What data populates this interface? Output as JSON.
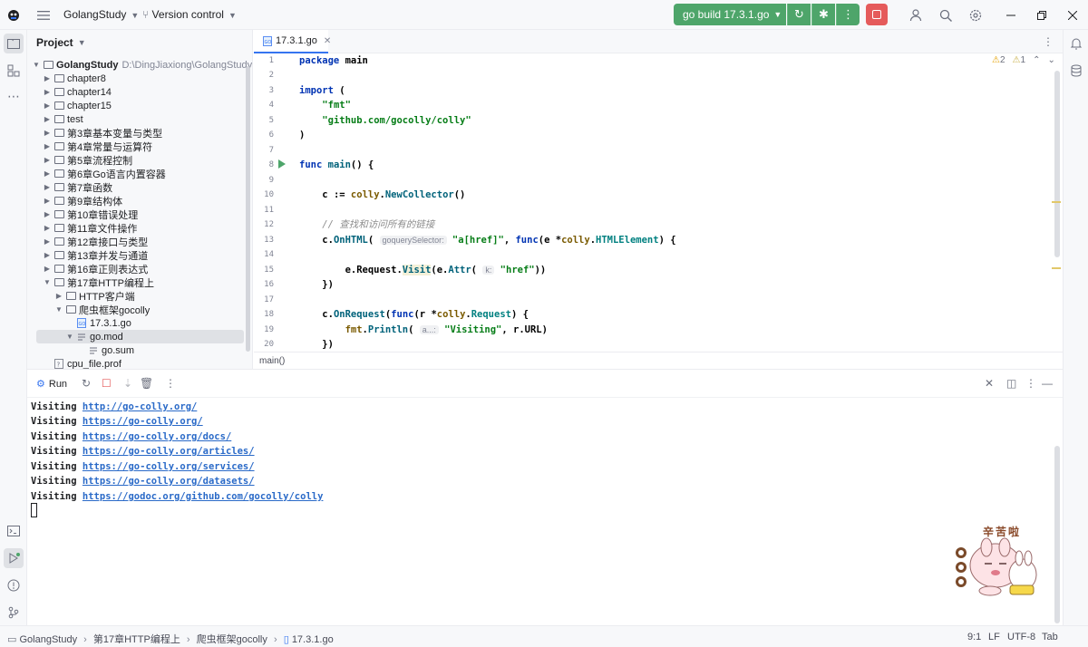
{
  "titlebar": {
    "project_name": "GolangStudy",
    "vcs_label": "Version control",
    "run_config": "go build 17.3.1.go"
  },
  "project_panel": {
    "title": "Project",
    "root_name": "GolangStudy",
    "root_path": "D:\\DingJiaxiong\\GolangStudy",
    "items": [
      "chapter8",
      "chapter14",
      "chapter15",
      "test",
      "第3章基本变量与类型",
      "第4章常量与运算符",
      "第5章流程控制",
      "第6章Go语言内置容器",
      "第7章函数",
      "第9章结构体",
      "第10章错误处理",
      "第11章文件操作",
      "第12章接口与类型",
      "第13章并发与通道",
      "第16章正则表达式",
      "第17章HTTP编程上",
      "HTTP客户端",
      "爬虫框架gocolly",
      "17.3.1.go",
      "go.mod",
      "go.sum",
      "cpu_file.prof"
    ]
  },
  "editor": {
    "tab_name": "17.3.1.go",
    "warnings": "2",
    "weak_warnings": "1",
    "line_numbers": [
      "1",
      "2",
      "3",
      "4",
      "5",
      "6",
      "7",
      "8",
      "9",
      "10",
      "11",
      "12",
      "13",
      "14",
      "15",
      "16",
      "17",
      "18",
      "19",
      "20"
    ],
    "breadcrumb": "main()",
    "hint_selector": "goquerySelector:",
    "hint_k": "k:",
    "hint_a": "a...:",
    "comment": "// 查找和访问所有的链接"
  },
  "run_panel": {
    "tab_label": "Run",
    "visiting_word": "Visiting",
    "urls": [
      "http://go-colly.org/",
      "https://go-colly.org/",
      "https://go-colly.org/docs/",
      "https://go-colly.org/articles/",
      "https://go-colly.org/services/",
      "https://go-colly.org/datasets/",
      "https://godoc.org/github.com/gocolly/colly"
    ]
  },
  "sticker": {
    "text": "辛苦啦"
  },
  "statusbar": {
    "crumbs": [
      "GolangStudy",
      "第17章HTTP编程上",
      "爬虫框架gocolly",
      "17.3.1.go"
    ],
    "position": "9:1",
    "line_sep": "LF",
    "encoding": "UTF-8",
    "indent": "Tab"
  },
  "icons": {
    "menu": "hamburger-icon",
    "branch": "branch-icon",
    "debug": "bug-icon",
    "search": "search-icon",
    "settings": "gear-icon"
  }
}
